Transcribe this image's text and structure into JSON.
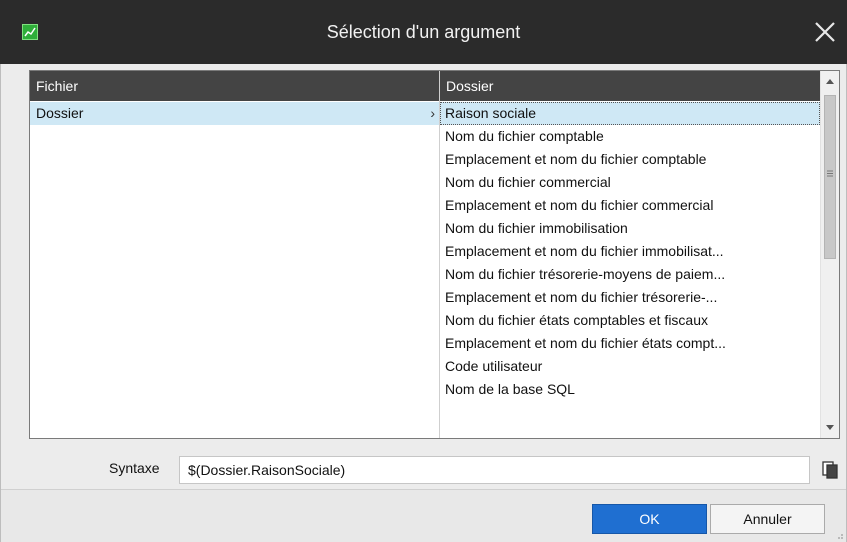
{
  "window": {
    "title": "Sélection d'un argument",
    "app_icon": "chart-app-icon",
    "close_icon": "close-icon"
  },
  "grid": {
    "left_header": "Fichier",
    "right_header": "Dossier",
    "left_items": [
      {
        "label": "Dossier",
        "selected": true,
        "chevron": "›"
      }
    ],
    "right_items": [
      {
        "label": "Raison sociale",
        "selected": true
      },
      {
        "label": "Nom du fichier comptable"
      },
      {
        "label": "Emplacement et nom du fichier comptable"
      },
      {
        "label": "Nom du fichier commercial"
      },
      {
        "label": "Emplacement et nom du fichier commercial"
      },
      {
        "label": "Nom du fichier immobilisation"
      },
      {
        "label": "Emplacement et nom du fichier immobilisat..."
      },
      {
        "label": "Nom du fichier trésorerie-moyens de paiem..."
      },
      {
        "label": "Emplacement et nom du fichier trésorerie-..."
      },
      {
        "label": "Nom du fichier états comptables et fiscaux"
      },
      {
        "label": "Emplacement et nom du fichier états compt..."
      },
      {
        "label": "Code utilisateur"
      },
      {
        "label": "Nom de la base SQL"
      }
    ]
  },
  "syntax": {
    "label": "Syntaxe",
    "value": "$(Dossier.RaisonSociale)",
    "copy_icon": "copy-icon"
  },
  "buttons": {
    "ok": "OK",
    "cancel": "Annuler"
  },
  "colors": {
    "titlebar": "#2b2b2b",
    "header": "#444444",
    "selection": "#cfe8f5",
    "primary_button": "#1f6fd1"
  }
}
